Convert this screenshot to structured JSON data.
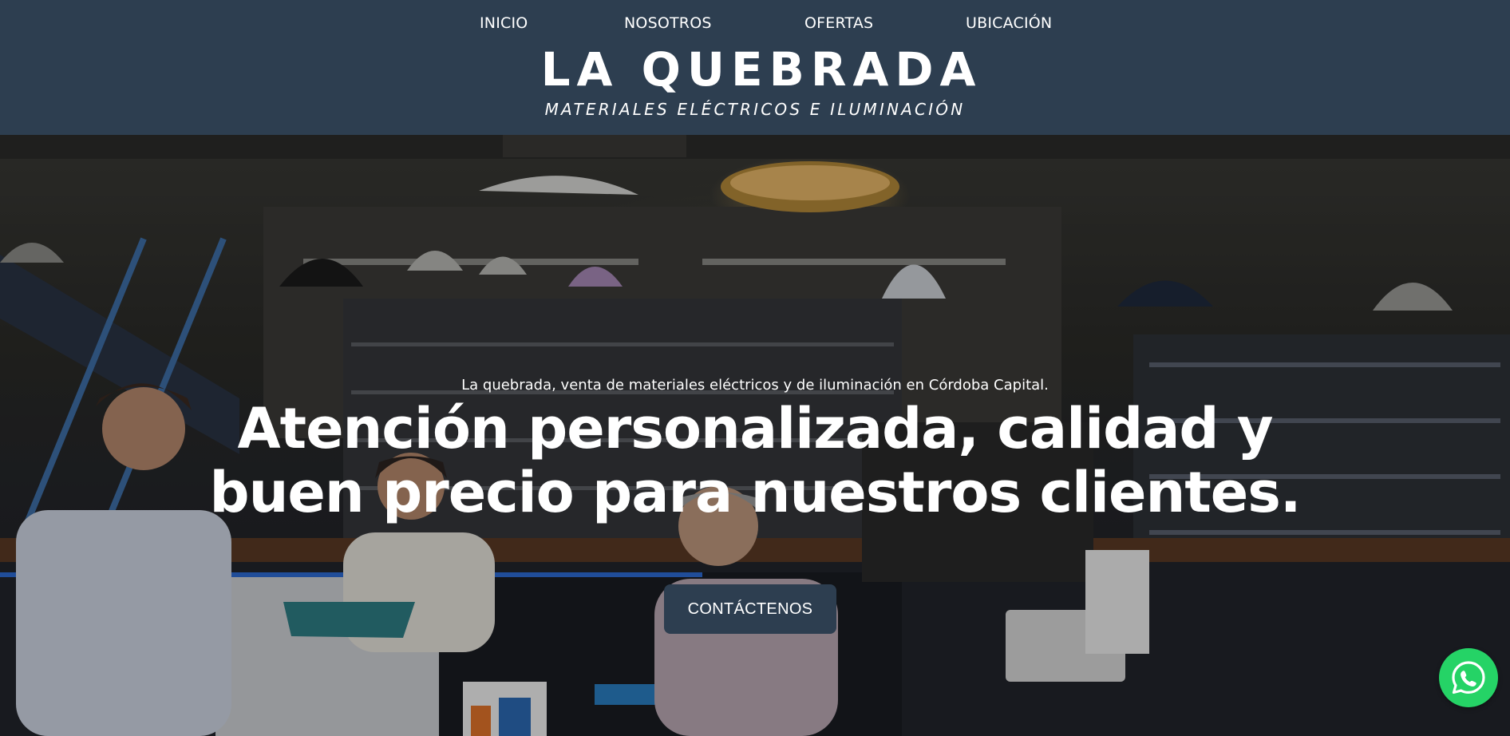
{
  "nav": {
    "items": [
      {
        "label": "INICIO"
      },
      {
        "label": "NOSOTROS"
      },
      {
        "label": "OFERTAS"
      },
      {
        "label": "UBICACIÓN"
      }
    ]
  },
  "brand": {
    "title": "LA QUEBRADA",
    "subtitle": "MATERIALES ELÉCTRICOS E ILUMINACIÓN"
  },
  "hero": {
    "tagline": "La quebrada, venta de materiales eléctricos y de iluminación en Córdoba Capital.",
    "headline_line1": "Atención personalizada, calidad y",
    "headline_line2": "buen precio para nuestros clientes.",
    "cta_label": "CONTÁCTENOS",
    "background_image": "store-interior-photo"
  },
  "whatsapp": {
    "icon": "whatsapp-icon",
    "color": "#25d366"
  },
  "colors": {
    "header_bg": "#2d3e50",
    "cta_bg": "#2d3e50",
    "text": "#ffffff"
  }
}
